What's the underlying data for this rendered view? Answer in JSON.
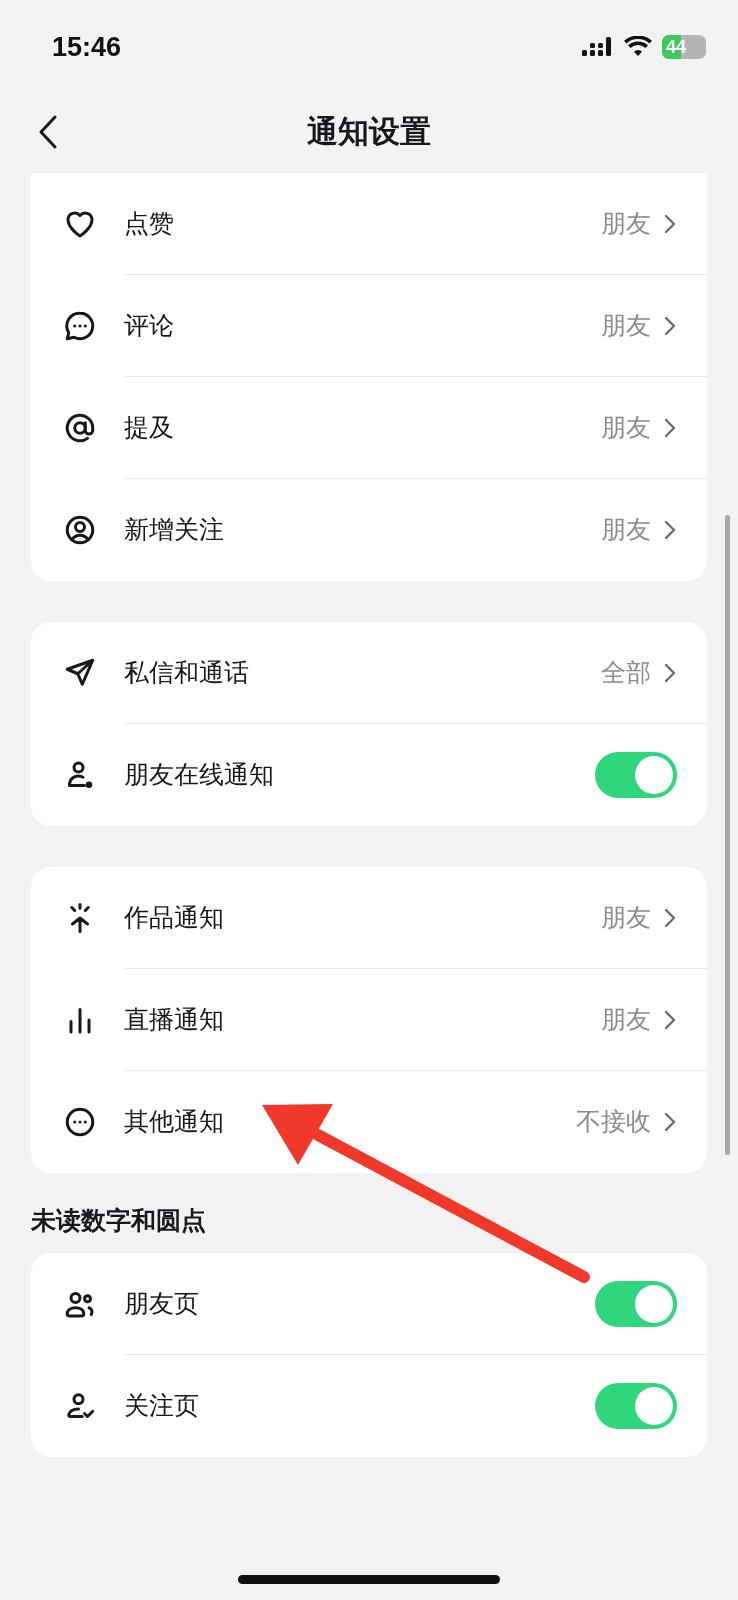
{
  "status_bar": {
    "time": "15:46",
    "battery": "44"
  },
  "nav": {
    "title": "通知设置"
  },
  "groups": [
    {
      "rows": [
        {
          "kind": "link",
          "label": "点赞",
          "value": "朋友"
        },
        {
          "kind": "link",
          "label": "评论",
          "value": "朋友"
        },
        {
          "kind": "link",
          "label": "提及",
          "value": "朋友"
        },
        {
          "kind": "link",
          "label": "新增关注",
          "value": "朋友"
        }
      ]
    },
    {
      "rows": [
        {
          "kind": "link",
          "label": "私信和通话",
          "value": "全部"
        },
        {
          "kind": "toggle",
          "label": "朋友在线通知",
          "on": true
        }
      ]
    },
    {
      "rows": [
        {
          "kind": "link",
          "label": "作品通知",
          "value": "朋友"
        },
        {
          "kind": "link",
          "label": "直播通知",
          "value": "朋友"
        },
        {
          "kind": "link",
          "label": "其他通知",
          "value": "不接收"
        }
      ]
    },
    {
      "header": "未读数字和圆点",
      "rows": [
        {
          "kind": "toggle",
          "label": "朋友页",
          "on": true
        },
        {
          "kind": "toggle",
          "label": "关注页",
          "on": true
        }
      ]
    }
  ]
}
